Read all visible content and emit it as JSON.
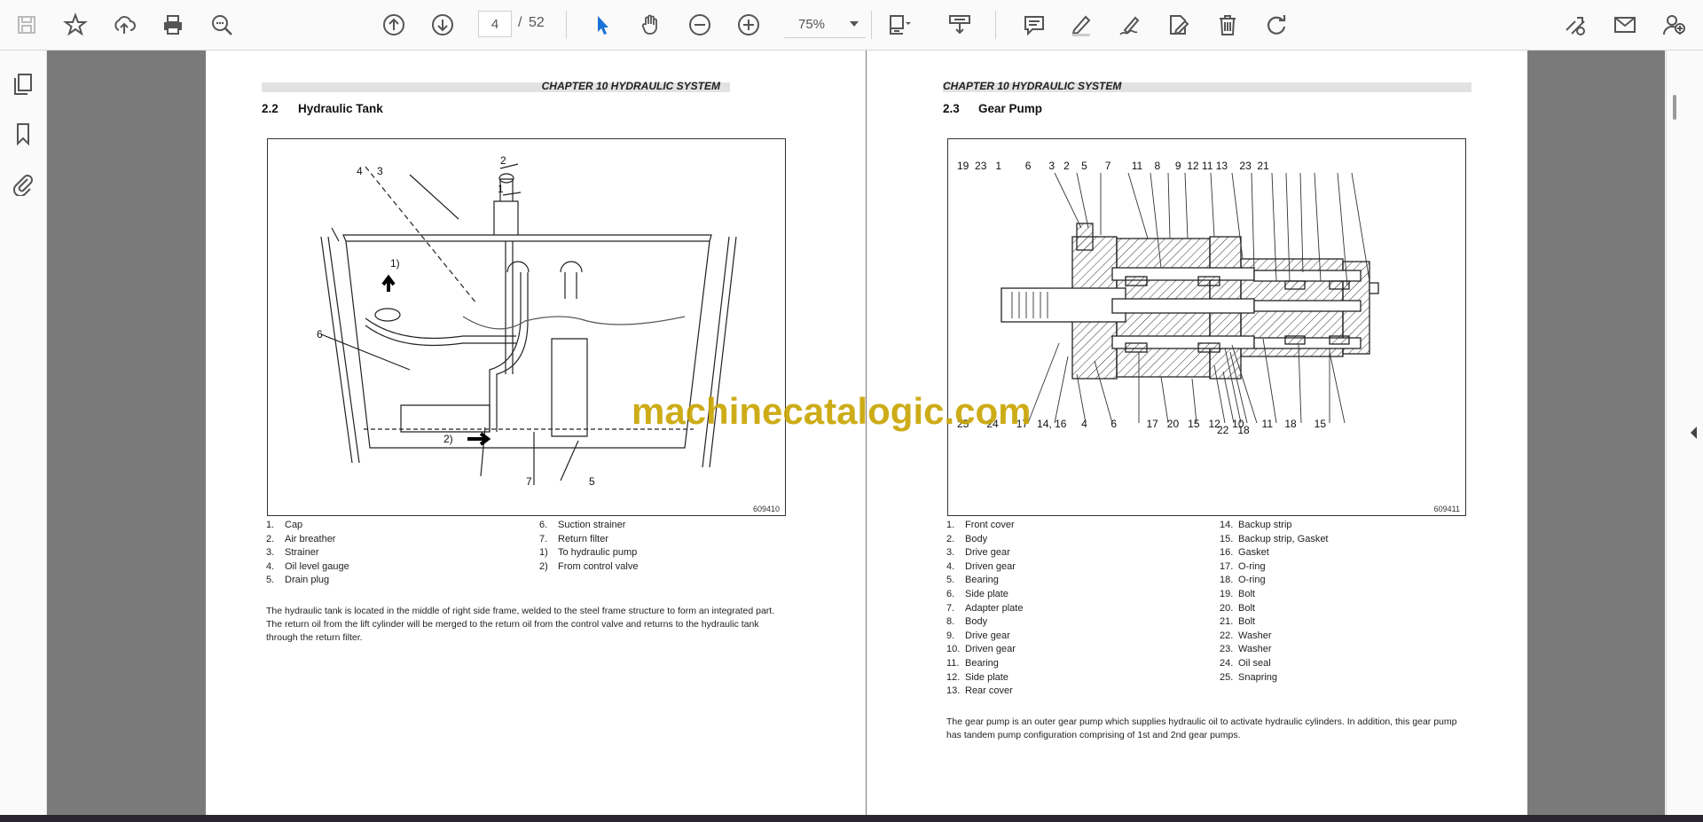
{
  "toolbar": {
    "current_page": "4",
    "page_separator": "/",
    "total_pages": "52",
    "zoom": "75%"
  },
  "watermark": "machinecatalogic.com",
  "left_page": {
    "chapter": "CHAPTER 10 HYDRAULIC SYSTEM",
    "section_no": "2.2",
    "section_title": "Hydraulic Tank",
    "figure_no": "609410",
    "callouts": [
      "1",
      "2",
      "3",
      "4",
      "5",
      "6",
      "7",
      "1)",
      "2)"
    ],
    "legend_col1": [
      {
        "n": "1.",
        "t": "Cap"
      },
      {
        "n": "2.",
        "t": "Air breather"
      },
      {
        "n": "3.",
        "t": "Strainer"
      },
      {
        "n": "4.",
        "t": "Oil level gauge"
      },
      {
        "n": "5.",
        "t": "Drain plug"
      }
    ],
    "legend_col2": [
      {
        "n": "6.",
        "t": "Suction strainer"
      },
      {
        "n": "7.",
        "t": "Return filter"
      },
      {
        "n": "1)",
        "t": "To hydraulic pump"
      },
      {
        "n": "2)",
        "t": "From control valve"
      }
    ],
    "paragraph": "The hydraulic tank is located in the middle of right side frame, welded to the steel frame structure to form an integrated part. The return oil from the lift cylinder will be merged to the return oil from the control valve and returns to the hydraulic tank through the return filter."
  },
  "right_page": {
    "chapter": "CHAPTER 10 HYDRAULIC SYSTEM",
    "section_no": "2.3",
    "section_title": "Gear Pump",
    "figure_no": "609411",
    "top_callouts": "19  23   1        6      3   2    5      7       11    8     9  12 11 13    23  21",
    "bottom_callouts": "25      24      17   14, 16     4        6          17   20   15   12    10      11    18      15",
    "bottom_callouts_low": "22   18",
    "legend_col1": [
      {
        "n": "1.",
        "t": "Front cover"
      },
      {
        "n": "2.",
        "t": "Body"
      },
      {
        "n": "3.",
        "t": "Drive gear"
      },
      {
        "n": "4.",
        "t": "Driven gear"
      },
      {
        "n": "5.",
        "t": "Bearing"
      },
      {
        "n": "6.",
        "t": "Side plate"
      },
      {
        "n": "7.",
        "t": "Adapter plate"
      },
      {
        "n": "8.",
        "t": "Body"
      },
      {
        "n": "9.",
        "t": "Drive gear"
      },
      {
        "n": "10.",
        "t": "Driven gear"
      },
      {
        "n": "11.",
        "t": "Bearing"
      },
      {
        "n": "12.",
        "t": "Side plate"
      },
      {
        "n": "13.",
        "t": "Rear cover"
      }
    ],
    "legend_col2": [
      {
        "n": "14.",
        "t": "Backup strip"
      },
      {
        "n": "15.",
        "t": "Backup strip, Gasket"
      },
      {
        "n": "16.",
        "t": "Gasket"
      },
      {
        "n": "17.",
        "t": "O-ring"
      },
      {
        "n": "18.",
        "t": "O-ring"
      },
      {
        "n": "19.",
        "t": "Bolt"
      },
      {
        "n": "20.",
        "t": "Bolt"
      },
      {
        "n": "21.",
        "t": "Bolt"
      },
      {
        "n": "22.",
        "t": "Washer"
      },
      {
        "n": "23.",
        "t": "Washer"
      },
      {
        "n": "24.",
        "t": "Oil seal"
      },
      {
        "n": "25.",
        "t": "Snapring"
      }
    ],
    "paragraph": "The gear pump is an outer gear pump which supplies hydraulic oil to activate hydraulic cylinders. In addition, this gear pump has tandem pump configuration comprising of 1st and 2nd gear pumps."
  }
}
